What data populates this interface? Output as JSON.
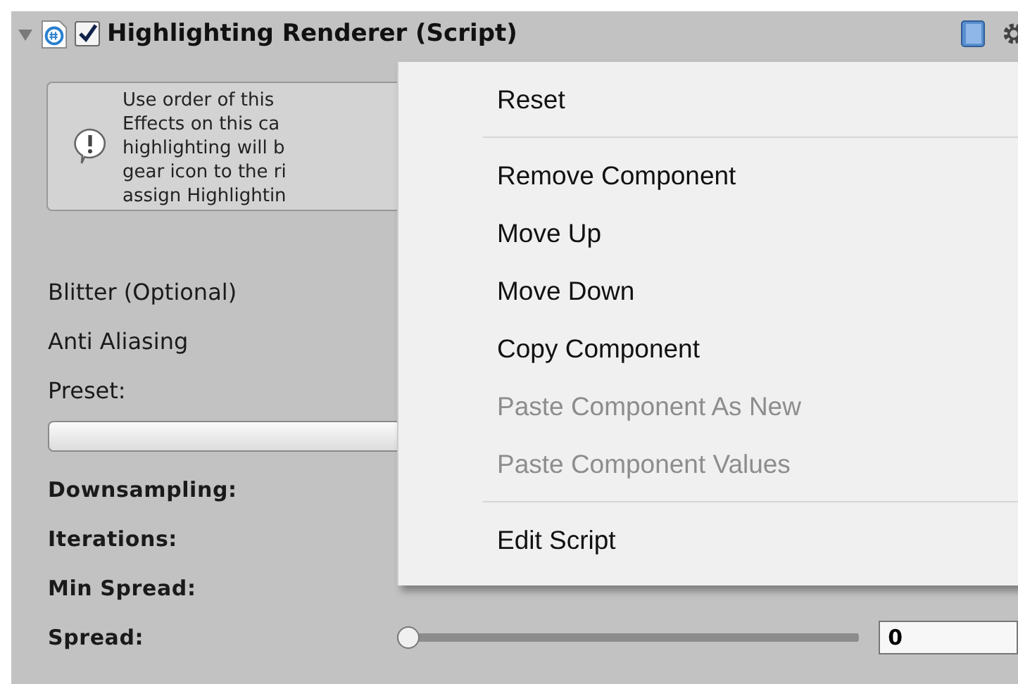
{
  "component": {
    "title": "Highlighting Renderer (Script)",
    "enabled": true,
    "expanded": true
  },
  "help_box": {
    "lines": [
      "Use order of this",
      "Effects on this ca",
      "highlighting will b",
      "gear icon to the ri",
      "assign Highlightin"
    ]
  },
  "fields": [
    {
      "label": "Blitter (Optional)",
      "kind": "label"
    },
    {
      "label": "Anti Aliasing",
      "kind": "label"
    },
    {
      "label": "Preset:",
      "kind": "label"
    },
    {
      "kind": "dropdown"
    },
    {
      "label": "Downsampling:",
      "kind": "bold"
    },
    {
      "label": "Iterations:",
      "kind": "bold"
    },
    {
      "label": "Min Spread:",
      "kind": "bold"
    },
    {
      "label": "Spread:",
      "kind": "slider",
      "level": 0,
      "value": "0"
    }
  ],
  "context_menu": {
    "items": [
      {
        "label": "Reset",
        "disabled": false,
        "kind": "item"
      },
      {
        "kind": "separator"
      },
      {
        "label": "Remove Component",
        "disabled": false,
        "kind": "item"
      },
      {
        "label": "Move Up",
        "disabled": false,
        "kind": "item"
      },
      {
        "label": "Move Down",
        "disabled": false,
        "kind": "item"
      },
      {
        "label": "Copy Component",
        "disabled": false,
        "kind": "item"
      },
      {
        "label": "Paste Component As New",
        "disabled": true,
        "kind": "item"
      },
      {
        "label": "Paste Component Values",
        "disabled": true,
        "kind": "item"
      },
      {
        "kind": "separator"
      },
      {
        "label": "Edit Script",
        "disabled": false,
        "kind": "item"
      }
    ]
  }
}
